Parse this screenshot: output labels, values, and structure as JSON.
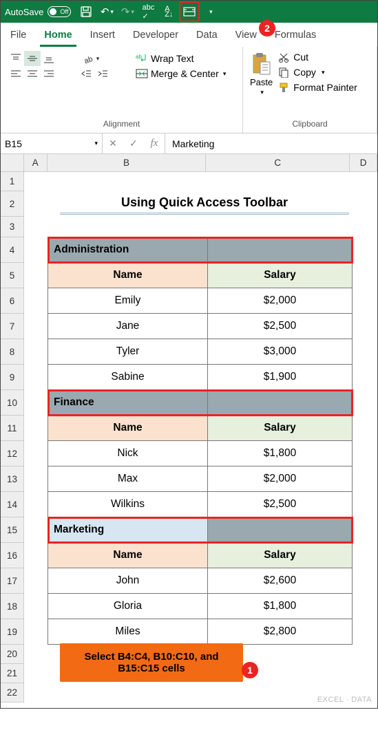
{
  "titlebar": {
    "autosave_label": "AutoSave",
    "autosave_state": "Off"
  },
  "tabs": [
    "File",
    "Home",
    "Insert",
    "Developer",
    "Data",
    "View",
    "Formulas"
  ],
  "ribbon": {
    "alignment": {
      "wrap_label": "Wrap Text",
      "merge_label": "Merge & Center",
      "group_label": "Alignment"
    },
    "clipboard": {
      "paste_label": "Paste",
      "cut_label": "Cut",
      "copy_label": "Copy",
      "format_painter_label": "Format Painter",
      "group_label": "Clipboard"
    }
  },
  "namebox": "B15",
  "formula_value": "Marketing",
  "columns": [
    "A",
    "B",
    "C",
    "D"
  ],
  "rows": [
    "1",
    "2",
    "3",
    "4",
    "5",
    "6",
    "7",
    "8",
    "9",
    "10",
    "11",
    "12",
    "13",
    "14",
    "15",
    "16",
    "17",
    "18",
    "19",
    "20",
    "21",
    "22"
  ],
  "sheet": {
    "title": "Using Quick Access Toolbar",
    "section1": {
      "header": "Administration",
      "name_col": "Name",
      "salary_col": "Salary",
      "rows": [
        {
          "name": "Emily",
          "salary": "$2,000"
        },
        {
          "name": "Jane",
          "salary": "$2,500"
        },
        {
          "name": "Tyler",
          "salary": "$3,000"
        },
        {
          "name": "Sabine",
          "salary": "$1,900"
        }
      ]
    },
    "section2": {
      "header": "Finance",
      "name_col": "Name",
      "salary_col": "Salary",
      "rows": [
        {
          "name": "Nick",
          "salary": "$1,800"
        },
        {
          "name": "Max",
          "salary": "$2,000"
        },
        {
          "name": "Wilkins",
          "salary": "$2,500"
        }
      ]
    },
    "section3": {
      "header": "Marketing",
      "name_col": "Name",
      "salary_col": "Salary",
      "rows": [
        {
          "name": "John",
          "salary": "$2,600"
        },
        {
          "name": "Gloria",
          "salary": "$1,800"
        },
        {
          "name": "Miles",
          "salary": "$2,800"
        }
      ]
    }
  },
  "instruction": "Select B4:C4, B10:C10, and B15:C15 cells",
  "callouts": {
    "one": "1",
    "two": "2"
  },
  "watermark": "EXCEL · DATA"
}
